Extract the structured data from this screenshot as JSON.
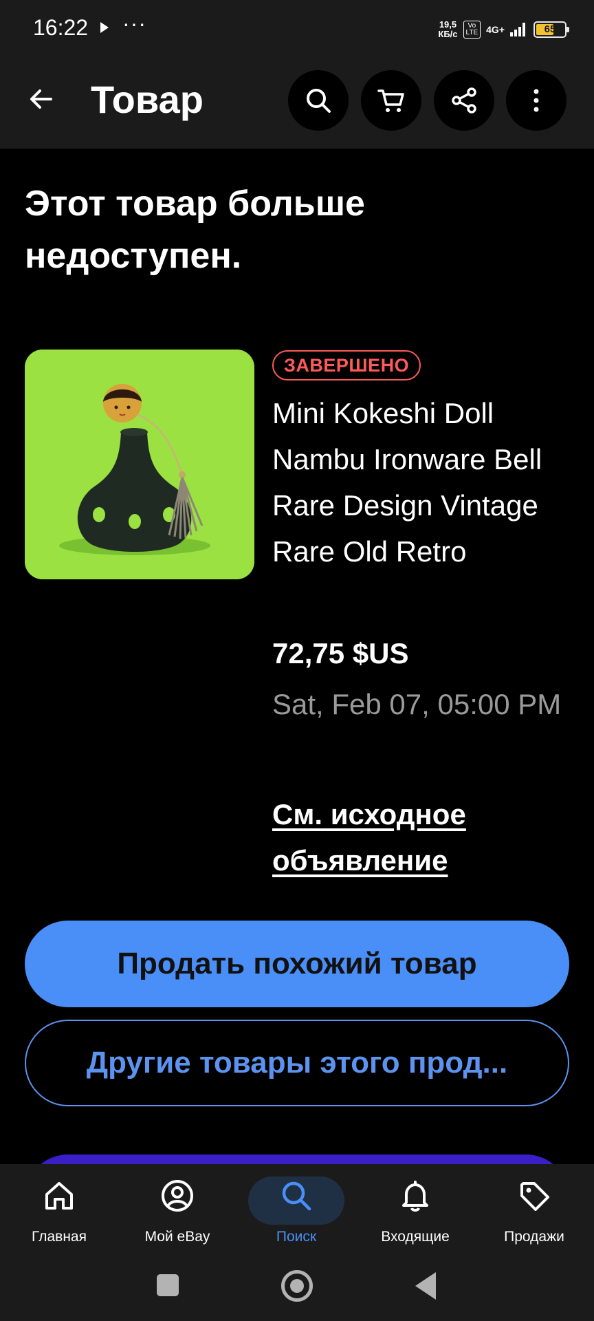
{
  "status_bar": {
    "time": "16:22",
    "more": "···",
    "speed_value": "19,5",
    "speed_unit": "КБ/с",
    "volte_top": "Vo",
    "volte_bottom": "LTE",
    "network": "4G+",
    "battery_level": "65"
  },
  "app_bar": {
    "title": "Товар",
    "icons": [
      "back-arrow-icon",
      "search-icon",
      "cart-icon",
      "share-icon",
      "more-vert-icon"
    ]
  },
  "listing": {
    "unavailable_message": "Этот товар больше недоступен.",
    "status_badge": "ЗАВЕРШЕНО",
    "title": "Mini Kokeshi Doll Nambu Ironware Bell Rare Design Vintage Rare Old Retro",
    "price": "72,75 $US",
    "end_date": "Sat, Feb 07, 05:00 PM",
    "original_listing_link": "См. исходное объявление"
  },
  "actions": {
    "sell_similar": "Продать похожий товар",
    "other_seller_items": "Другие товары этого прод..."
  },
  "bottom_nav": {
    "items": [
      {
        "label": "Главная",
        "icon": "home-icon"
      },
      {
        "label": "Мой eBay",
        "icon": "account-icon"
      },
      {
        "label": "Поиск",
        "icon": "search-icon",
        "active": true
      },
      {
        "label": "Входящие",
        "icon": "bell-icon"
      },
      {
        "label": "Продажи",
        "icon": "tag-icon"
      }
    ]
  },
  "colors": {
    "accent": "#4a8ff7",
    "badge": "#ff5a5a",
    "bar_bg": "#1b1b1b",
    "background": "#000000"
  }
}
